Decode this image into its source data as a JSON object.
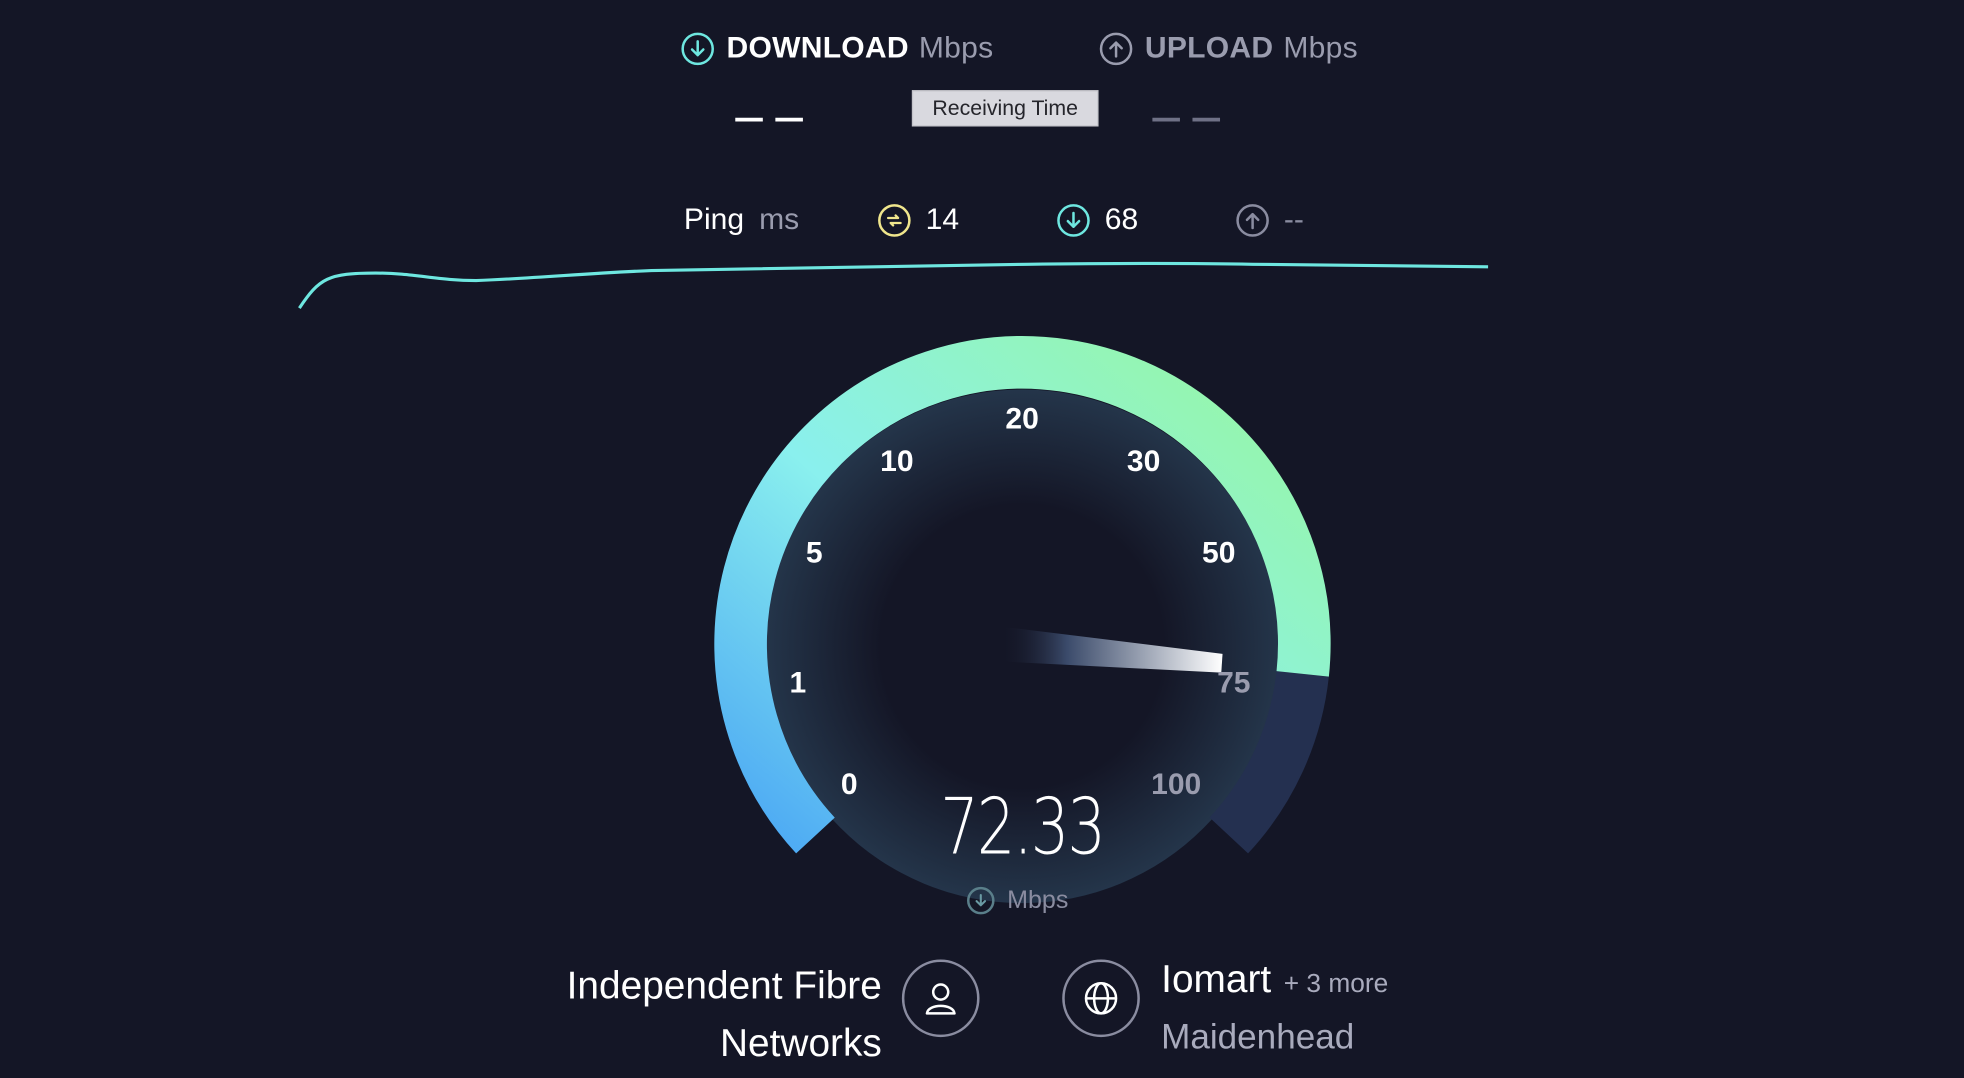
{
  "header": {
    "download_label": "DOWNLOAD",
    "download_unit": "Mbps",
    "upload_label": "UPLOAD",
    "upload_unit": "Mbps",
    "tooltip": "Receiving Time"
  },
  "ping": {
    "label": "Ping",
    "unit": "ms",
    "idle": "14",
    "download": "68",
    "upload": "--"
  },
  "gauge": {
    "ticks": [
      "0",
      "1",
      "5",
      "10",
      "20",
      "30",
      "50",
      "75",
      "100"
    ],
    "current_value": "72.33",
    "current_unit": "Mbps"
  },
  "provider": {
    "isp_line1": "Independent Fibre",
    "isp_line2": "Networks",
    "server": "Iomart",
    "server_more": "+ 3 more",
    "server_location": "Maidenhead"
  },
  "colors": {
    "background": "#141626",
    "download_accent": "#6ee7e0",
    "idle_accent": "#f0e68c",
    "gauge_low": "#4ab3f4",
    "gauge_high": "#98f7a0"
  }
}
